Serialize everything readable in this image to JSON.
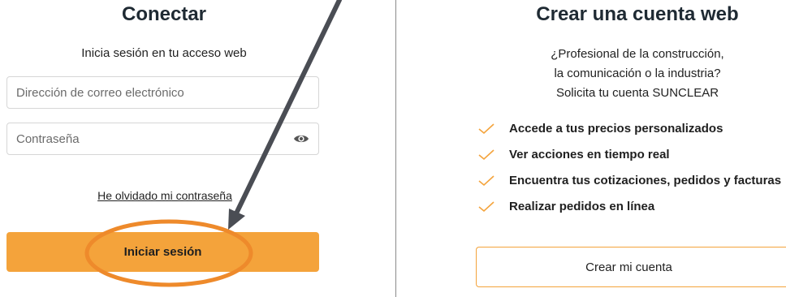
{
  "login": {
    "title": "Conectar",
    "subtitle": "Inicia sesión en tu acceso web",
    "email_placeholder": "Dirección de correo electrónico",
    "password_placeholder": "Contraseña",
    "show_password_icon": "eye-icon",
    "forgot_password": "He olvidado mi contraseña",
    "submit_label": "Iniciar sesión"
  },
  "signup": {
    "title": "Crear una cuenta web",
    "intro_lines": [
      "¿Profesional de la construcción,",
      "la comunicación o la industria?",
      "Solicita tu cuenta SUNCLEAR"
    ],
    "benefits": [
      "Accede a tus precios personalizados",
      "Ver acciones en tiempo real",
      "Encuentra tus cotizaciones, pedidos y facturas",
      "Realizar pedidos en línea"
    ],
    "benefit_icon": "check-icon",
    "create_label": "Crear mi cuenta"
  },
  "annotations": {
    "arrow_icon": "arrow-icon",
    "highlight_icon": "highlight-ellipse-icon"
  },
  "colors": {
    "accent": "#f4a33b",
    "annotation_orange": "#ee8a2b",
    "arrow": "#4a4d54",
    "divider": "#8a8a8a"
  }
}
